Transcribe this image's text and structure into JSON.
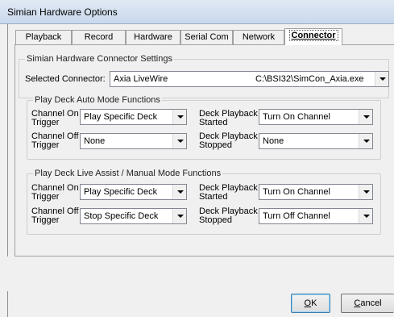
{
  "window": {
    "title": "Simian Hardware Options"
  },
  "tabs": [
    {
      "label": "Playback"
    },
    {
      "label": "Record"
    },
    {
      "label": "Hardware"
    },
    {
      "label": "Serial Com"
    },
    {
      "label": "Network"
    },
    {
      "label": "Connector",
      "active": true
    }
  ],
  "connector_group": {
    "legend": "Simian Hardware Connector Settings",
    "selected_label": "Selected Connector:",
    "selected_name": "Axia LiveWire",
    "selected_path": "C:\\BSI32\\SimCon_Axia.exe"
  },
  "auto_group": {
    "legend": "Play Deck Auto Mode Functions",
    "on_label_1": "Channel On",
    "on_label_2": "Trigger",
    "on_value": "Play Specific Deck",
    "off_label_1": "Channel Off",
    "off_label_2": "Trigger",
    "off_value": "None",
    "started_label_1": "Deck Playback",
    "started_label_2": "Started",
    "started_value": "Turn On Channel",
    "stopped_label_1": "Deck Playback",
    "stopped_label_2": "Stopped",
    "stopped_value": "None"
  },
  "assist_group": {
    "legend": "Play Deck Live Assist / Manual Mode Functions",
    "on_label_1": "Channel On",
    "on_label_2": "Trigger",
    "on_value": "Play Specific Deck",
    "off_label_1": "Channel Off",
    "off_label_2": "Trigger",
    "off_value": "Stop Specific Deck",
    "started_label_1": "Deck Playback",
    "started_label_2": "Started",
    "started_value": "Turn On Channel",
    "stopped_label_1": "Deck Playback",
    "stopped_label_2": "Stopped",
    "stopped_value": "Turn Off Channel"
  },
  "buttons": {
    "ok_mnemonic": "O",
    "ok_rest": "K",
    "cancel_mnemonic": "C",
    "cancel_rest": "ancel"
  }
}
